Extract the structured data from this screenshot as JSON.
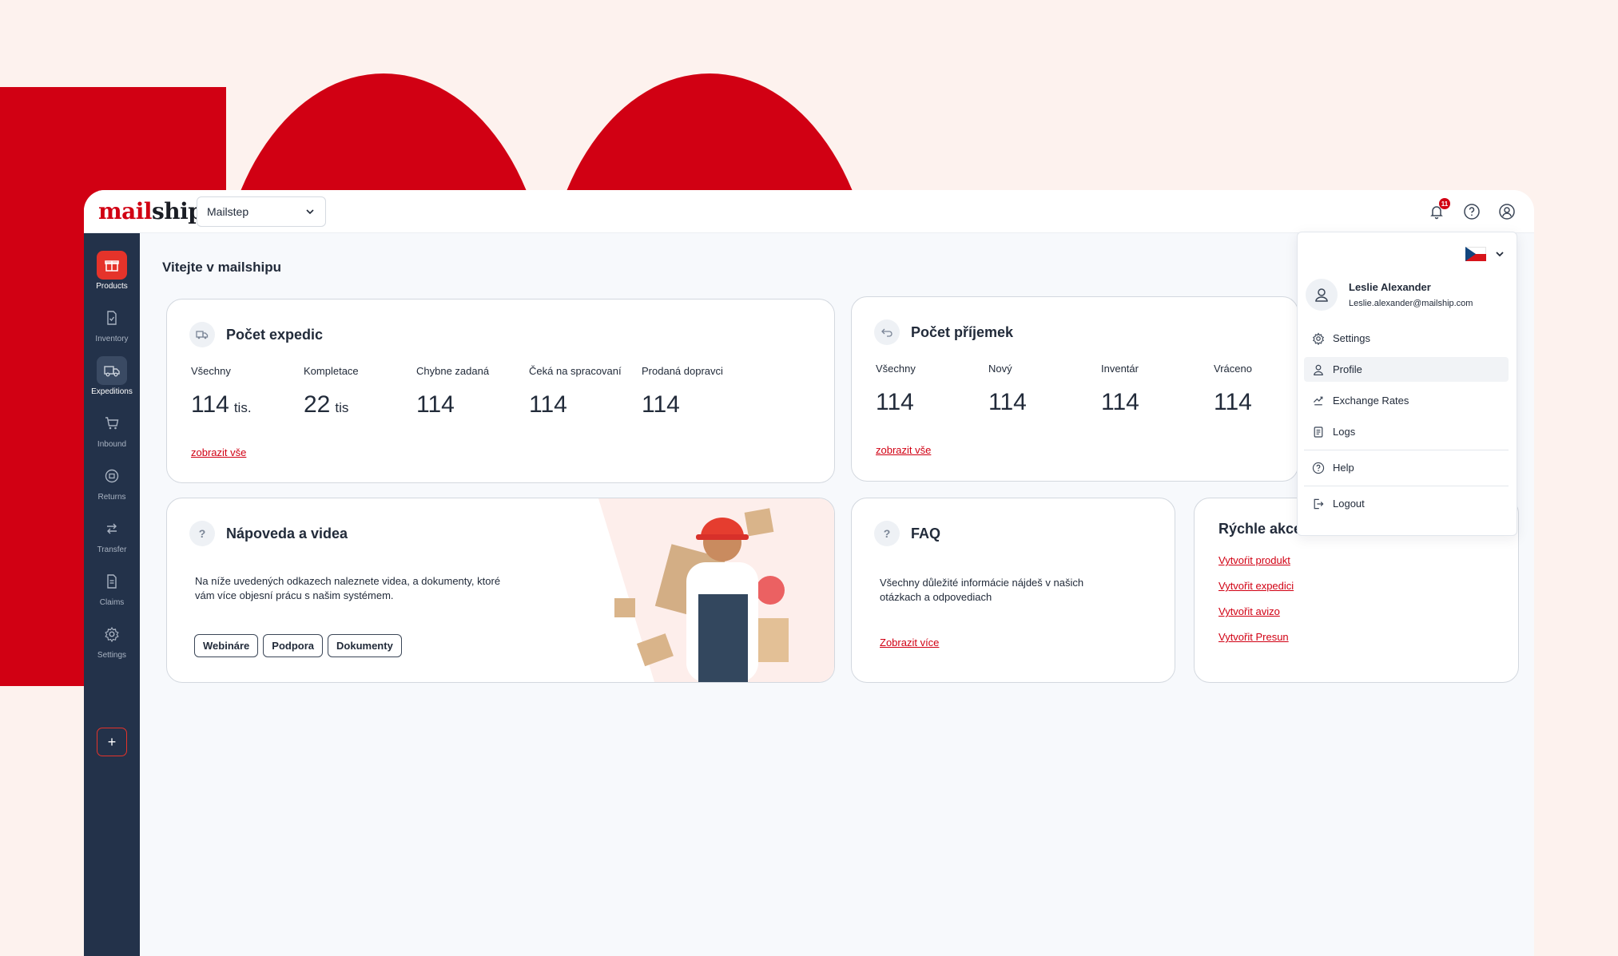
{
  "app": {
    "logo_text_1": "mail",
    "logo_text_2": "ship",
    "org_select": "Mailstep",
    "notification_count": "11",
    "page_title": "Vitejte v mailshipu"
  },
  "colors": {
    "brand_red": "#d10013",
    "sidebar_bg": "#23324a",
    "active_item": "#e5332a"
  },
  "sidebar": {
    "items": [
      {
        "label": "Products",
        "icon": "gift-icon"
      },
      {
        "label": "Inventory",
        "icon": "document-check-icon"
      },
      {
        "label": "Expeditions",
        "icon": "truck-icon"
      },
      {
        "label": "Inbound",
        "icon": "cart-icon"
      },
      {
        "label": "Returns",
        "icon": "return-box-icon"
      },
      {
        "label": "Transfer",
        "icon": "transfer-arrows-icon"
      },
      {
        "label": "Claims",
        "icon": "document-icon"
      },
      {
        "label": "Settings",
        "icon": "gear-icon"
      }
    ],
    "add_label": "+"
  },
  "expedice": {
    "title": "Počet expedic",
    "stats": [
      {
        "label": "Všechny",
        "value": "114",
        "unit": "tis."
      },
      {
        "label": "Kompletace",
        "value": "22",
        "unit": "tis"
      },
      {
        "label": "Chybne zadaná",
        "value": "114",
        "unit": ""
      },
      {
        "label": "Čeká na spracovaní",
        "value": "114",
        "unit": ""
      },
      {
        "label": "Prodaná dopravci",
        "value": "114",
        "unit": ""
      }
    ],
    "link": "zobrazit vše"
  },
  "prijemky": {
    "title": "Počet příjemek",
    "stats": [
      {
        "label": "Všechny",
        "value": "114"
      },
      {
        "label": "Nový",
        "value": "114"
      },
      {
        "label": "Inventár",
        "value": "114"
      },
      {
        "label": "Vráceno",
        "value": "114"
      }
    ],
    "link": "zobrazit vše"
  },
  "napoveda": {
    "title": "Nápoveda a videa",
    "text": "Na níže uvedených odkazech naleznete videa, a dokumenty, ktoré vám více objesní prácu s našim systémem.",
    "buttons": [
      "Webináre",
      "Podpora",
      "Dokumenty"
    ]
  },
  "faq": {
    "title": "FAQ",
    "text": "Všechny důležité informácie nájdeš v našich otázkach a odpovediach",
    "link": "Zobrazit více"
  },
  "rychle": {
    "title": "Rýchle akce",
    "links": [
      "Vytvoŕit produkt",
      "Vytvořit expedici",
      "Vytvořit avizo",
      "Vytvořit Presun"
    ]
  },
  "user_menu": {
    "name": "Leslie Alexander",
    "email": "Leslie.alexander@mailship.com",
    "items": [
      {
        "label": "Settings",
        "icon": "gear-icon"
      },
      {
        "label": "Profile",
        "icon": "user-icon"
      },
      {
        "label": "Exchange Rates",
        "icon": "exchange-icon"
      },
      {
        "label": "Logs",
        "icon": "logs-icon"
      },
      {
        "label": "Help",
        "icon": "help-circle-icon"
      },
      {
        "label": "Logout",
        "icon": "logout-icon"
      }
    ]
  }
}
